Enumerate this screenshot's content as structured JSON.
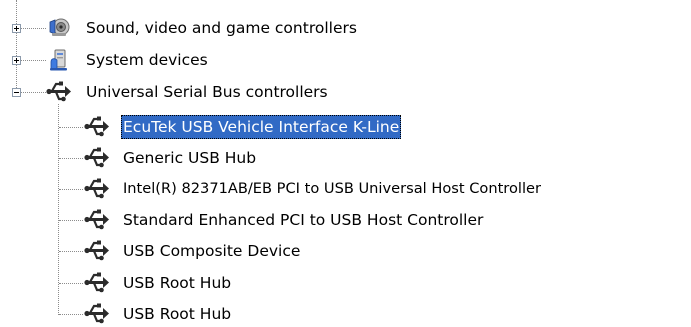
{
  "tree": {
    "categories": [
      {
        "label": "Sound, video and game controllers",
        "icon": "speaker-icon",
        "expanded": false
      },
      {
        "label": "System devices",
        "icon": "computer-icon",
        "expanded": false
      },
      {
        "label": "Universal Serial Bus controllers",
        "icon": "usb-icon",
        "expanded": true
      }
    ],
    "usb_devices": [
      {
        "label": "EcuTek USB Vehicle Interface K-Line",
        "icon": "usb-icon",
        "selected": true
      },
      {
        "label": "Generic USB Hub",
        "icon": "usb-icon",
        "selected": false
      },
      {
        "label": "Intel(R) 82371AB/EB PCI to USB Universal Host Controller",
        "icon": "usb-icon",
        "selected": false
      },
      {
        "label": "Standard Enhanced PCI to USB Host Controller",
        "icon": "usb-icon",
        "selected": false
      },
      {
        "label": "USB Composite Device",
        "icon": "usb-icon",
        "selected": false
      },
      {
        "label": "USB Root Hub",
        "icon": "usb-icon",
        "selected": false
      },
      {
        "label": "USB Root Hub",
        "icon": "usb-icon",
        "selected": false
      }
    ]
  },
  "colors": {
    "selection": "#316ac5",
    "tree_lines": "#8c8c8c"
  }
}
